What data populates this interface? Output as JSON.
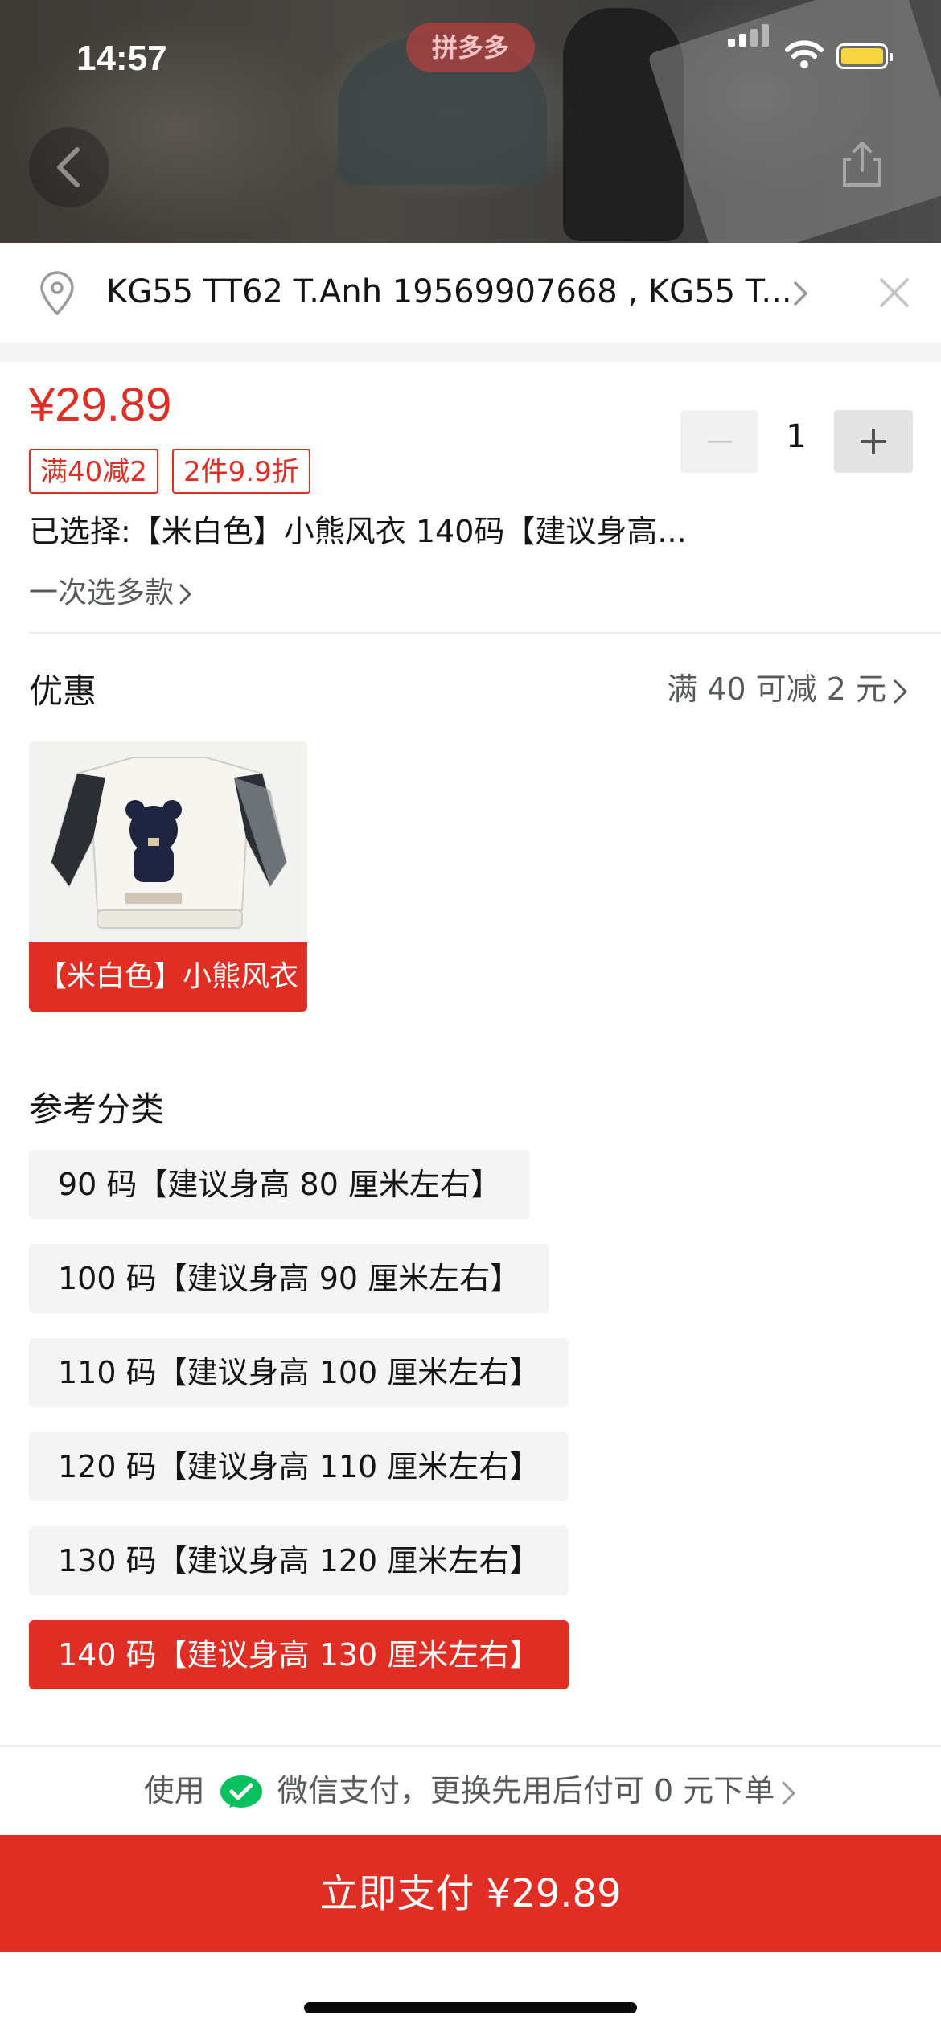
{
  "status_bar": {
    "time": "14:57"
  },
  "header": {
    "brand": "拼多多"
  },
  "address": {
    "text": "KG55 TT62 T.Anh 19569907668 , KG55 T..."
  },
  "product": {
    "price": "¥29.89",
    "tags": [
      "满40减2",
      "2件9.9折"
    ],
    "quantity": "1",
    "selected_text": "已选择:【米白色】小熊风衣 140码【建议身高...",
    "multi_select_label": "一次选多款"
  },
  "promotion": {
    "title": "优惠",
    "detail": "满 40 可减 2 元"
  },
  "color_option": {
    "label": "【米白色】小熊风衣"
  },
  "size_section": {
    "title": "参考分类",
    "options": [
      "90 码【建议身高 80 厘米左右】",
      "100 码【建议身高 90 厘米左右】",
      "110 码【建议身高 100 厘米左右】",
      "120 码【建议身高 110 厘米左右】",
      "130 码【建议身高 120 厘米左右】",
      "140 码【建议身高 130 厘米左右】"
    ],
    "selected_index": 5
  },
  "payment": {
    "prefix": "使用",
    "method_text": "微信支付，更换先用后付可 0 元下单",
    "pay_button": "立即支付 ¥29.89"
  },
  "colors": {
    "accent": "#e02e24",
    "wechat": "#07c160"
  }
}
